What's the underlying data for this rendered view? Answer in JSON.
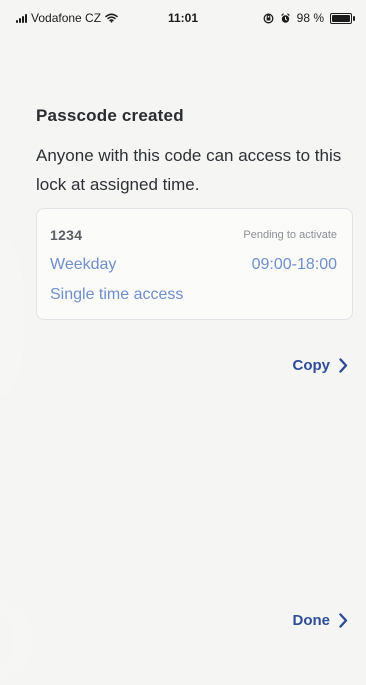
{
  "status_bar": {
    "carrier": "Vodafone CZ",
    "time": "11:01",
    "battery_percent": "98 %",
    "battery_level": 0.98
  },
  "screen": {
    "title": "Passcode created",
    "description": "Anyone with this code can access to this lock at assigned time."
  },
  "passcode_card": {
    "code": "1234",
    "status": "Pending to activate",
    "schedule": "Weekday",
    "time_range": "09:00-18:00",
    "access_type": "Single time access"
  },
  "actions": {
    "copy_label": "Copy",
    "done_label": "Done"
  },
  "icons": {
    "signal": "signal-icon",
    "wifi": "wifi-icon",
    "alarm": "alarm-icon",
    "lock": "orientation-lock-icon",
    "battery": "battery-icon",
    "chevron": "chevron-right-icon"
  },
  "colors": {
    "background": "#f5f5f3",
    "title": "#2a2c31",
    "accent_link": "#2f4d97",
    "secondary_blue": "#6f8fcd",
    "card_border": "#e2e3e6"
  }
}
